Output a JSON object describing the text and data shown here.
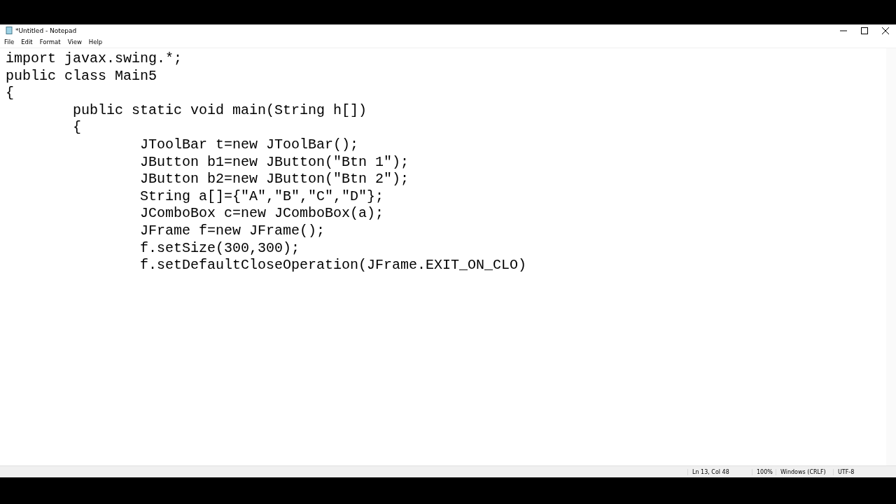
{
  "window": {
    "title": "*Untitled - Notepad"
  },
  "menu": [
    "File",
    "Edit",
    "Format",
    "View",
    "Help"
  ],
  "editor": {
    "lines": [
      "import javax.swing.*;",
      "public class Main5",
      "{",
      "\tpublic static void main(String h[])",
      "\t{",
      "\t\tJToolBar t=new JToolBar();",
      "\t\tJButton b1=new JButton(\"Btn 1\");",
      "\t\tJButton b2=new JButton(\"Btn 2\");",
      "\t\tString a[]={\"A\",\"B\",\"C\",\"D\"};",
      "\t\tJComboBox c=new JComboBox(a);",
      "\t\tJFrame f=new JFrame();",
      "\t\tf.setSize(300,300);",
      "\t\tf.setDefaultCloseOperation(JFrame.EXIT_ON_CLO)"
    ]
  },
  "status_bar": {
    "position": "Ln 13, Col 48",
    "zoom": "100%",
    "line_ending": "Windows (CRLF)",
    "encoding": "UTF-8"
  }
}
